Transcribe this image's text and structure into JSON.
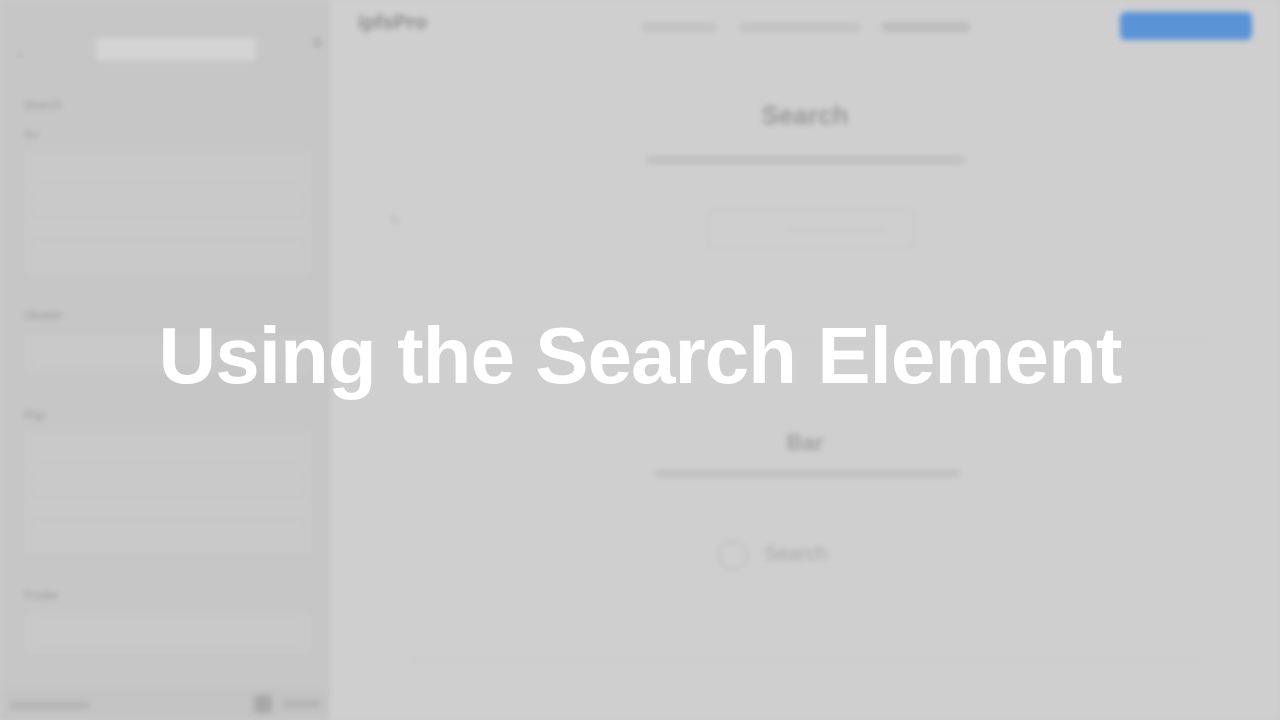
{
  "overlay": {
    "title": "Using the Search Element"
  },
  "background_app": {
    "blurred": true,
    "sidebar": {
      "sections": [
        {
          "label": "Search",
          "sub_label": "Bar"
        },
        {
          "label": "Header"
        },
        {
          "label": "Pop"
        },
        {
          "label": "Footer"
        }
      ]
    },
    "header": {
      "logo": "ipfsPro",
      "button_label": ""
    },
    "main": {
      "section2_title": "Bar",
      "search_button_label": "Search"
    }
  },
  "colors": {
    "background": "#cbcbcb",
    "overlay_text": "#ffffff",
    "accent_button": "#5a93d6"
  }
}
